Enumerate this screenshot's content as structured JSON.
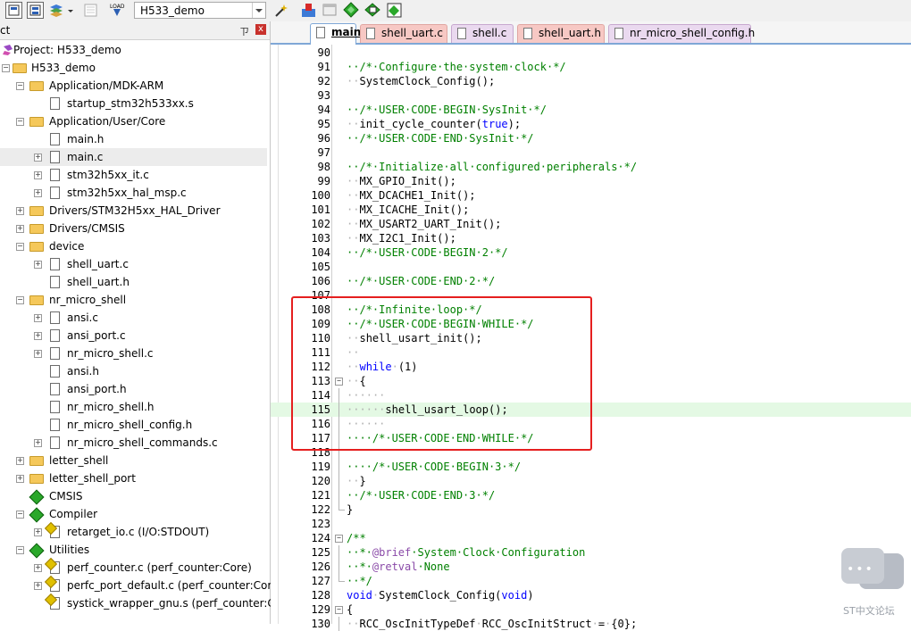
{
  "toolbar": {
    "project_select_value": "H533_demo",
    "icons": [
      "new-file-icon",
      "save-icon",
      "build-stack-icon",
      "cut-icon",
      "load-download-icon",
      "magic-wand-icon",
      "run-icon",
      "window-icon",
      "green-diamond-icon",
      "manage-icon",
      "multi-project-icon"
    ]
  },
  "project_panel": {
    "title": "ct",
    "pin": "ㄗ",
    "close": "x",
    "rows": [
      {
        "label": "Project: H533_demo",
        "type": "project"
      },
      {
        "label": "H533_demo",
        "type": "target"
      },
      {
        "label": "Application/MDK-ARM",
        "type": "folder"
      },
      {
        "label": "startup_stm32h533xx.s",
        "type": "file"
      },
      {
        "label": "Application/User/Core",
        "type": "folder"
      },
      {
        "label": "main.h",
        "type": "file"
      },
      {
        "label": "main.c",
        "type": "file"
      },
      {
        "label": "stm32h5xx_it.c",
        "type": "file"
      },
      {
        "label": "stm32h5xx_hal_msp.c",
        "type": "file"
      },
      {
        "label": "Drivers/STM32H5xx_HAL_Driver",
        "type": "folder"
      },
      {
        "label": "Drivers/CMSIS",
        "type": "folder"
      },
      {
        "label": "device",
        "type": "folder"
      },
      {
        "label": "shell_uart.c",
        "type": "file"
      },
      {
        "label": "shell_uart.h",
        "type": "file"
      },
      {
        "label": "nr_micro_shell",
        "type": "folder"
      },
      {
        "label": "ansi.c",
        "type": "file"
      },
      {
        "label": "ansi_port.c",
        "type": "file"
      },
      {
        "label": "nr_micro_shell.c",
        "type": "file"
      },
      {
        "label": "ansi.h",
        "type": "file"
      },
      {
        "label": "ansi_port.h",
        "type": "file"
      },
      {
        "label": "nr_micro_shell.h",
        "type": "file"
      },
      {
        "label": "nr_micro_shell_config.h",
        "type": "file"
      },
      {
        "label": "nr_micro_shell_commands.c",
        "type": "file"
      },
      {
        "label": "letter_shell",
        "type": "folder"
      },
      {
        "label": "letter_shell_port",
        "type": "folder"
      },
      {
        "label": "CMSIS",
        "type": "component"
      },
      {
        "label": "Compiler",
        "type": "component"
      },
      {
        "label": "retarget_io.c (I/O:STDOUT)",
        "type": "cfile"
      },
      {
        "label": "Utilities",
        "type": "component"
      },
      {
        "label": "perf_counter.c (perf_counter:Core)",
        "type": "cfile"
      },
      {
        "label": "perfc_port_default.c (perf_counter:Core)",
        "type": "cfile"
      },
      {
        "label": "systick_wrapper_gnu.s (perf_counter:Core)",
        "type": "cfile"
      }
    ]
  },
  "tabs": [
    {
      "label": "main.c",
      "active": true
    },
    {
      "label": "shell_uart.c",
      "active": false
    },
    {
      "label": "shell.c",
      "active": false
    },
    {
      "label": "shell_uart.h",
      "active": false
    },
    {
      "label": "nr_micro_shell_config.h",
      "active": false
    }
  ],
  "code_lines": [
    {
      "n": "90",
      "text": ""
    },
    {
      "n": "91",
      "text": "··/*·Configure·the·system·clock·*/"
    },
    {
      "n": "92",
      "text": "··SystemClock_Config();"
    },
    {
      "n": "93",
      "text": ""
    },
    {
      "n": "94",
      "text": "··/*·USER·CODE·BEGIN·SysInit·*/"
    },
    {
      "n": "95",
      "text": "··init_cycle_counter(true);"
    },
    {
      "n": "96",
      "text": "··/*·USER·CODE·END·SysInit·*/"
    },
    {
      "n": "97",
      "text": ""
    },
    {
      "n": "98",
      "text": "··/*·Initialize·all·configured·peripherals·*/"
    },
    {
      "n": "99",
      "text": "··MX_GPIO_Init();"
    },
    {
      "n": "100",
      "text": "··MX_DCACHE1_Init();"
    },
    {
      "n": "101",
      "text": "··MX_ICACHE_Init();"
    },
    {
      "n": "102",
      "text": "··MX_USART2_UART_Init();"
    },
    {
      "n": "103",
      "text": "··MX_I2C1_Init();"
    },
    {
      "n": "104",
      "text": "··/*·USER·CODE·BEGIN·2·*/"
    },
    {
      "n": "105",
      "text": ""
    },
    {
      "n": "106",
      "text": "··/*·USER·CODE·END·2·*/"
    },
    {
      "n": "107",
      "text": ""
    },
    {
      "n": "108",
      "text": "··/*·Infinite·loop·*/"
    },
    {
      "n": "109",
      "text": "··/*·USER·CODE·BEGIN·WHILE·*/"
    },
    {
      "n": "110",
      "text": "··shell_usart_init();"
    },
    {
      "n": "111",
      "text": "··"
    },
    {
      "n": "112",
      "text": "··while·(1)"
    },
    {
      "n": "113",
      "text": "··{"
    },
    {
      "n": "114",
      "text": "······"
    },
    {
      "n": "115",
      "text": "······shell_usart_loop();"
    },
    {
      "n": "116",
      "text": "······"
    },
    {
      "n": "117",
      "text": "····/*·USER·CODE·END·WHILE·*/"
    },
    {
      "n": "118",
      "text": ""
    },
    {
      "n": "119",
      "text": "····/*·USER·CODE·BEGIN·3·*/"
    },
    {
      "n": "120",
      "text": "··}"
    },
    {
      "n": "121",
      "text": "··/*·USER·CODE·END·3·*/"
    },
    {
      "n": "122",
      "text": "}"
    },
    {
      "n": "123",
      "text": ""
    },
    {
      "n": "124",
      "text": "/**"
    },
    {
      "n": "125",
      "text": "··*·@brief·System·Clock·Configuration"
    },
    {
      "n": "126",
      "text": "··*·@retval·None"
    },
    {
      "n": "127",
      "text": "··*/"
    },
    {
      "n": "128",
      "text": "void·SystemClock_Config(void)"
    },
    {
      "n": "129",
      "text": "{"
    },
    {
      "n": "130",
      "text": "··RCC_OscInitTypeDef·RCC_OscInitStruct·=·{0};"
    }
  ],
  "watermark": {
    "text": "ST中文论坛"
  }
}
